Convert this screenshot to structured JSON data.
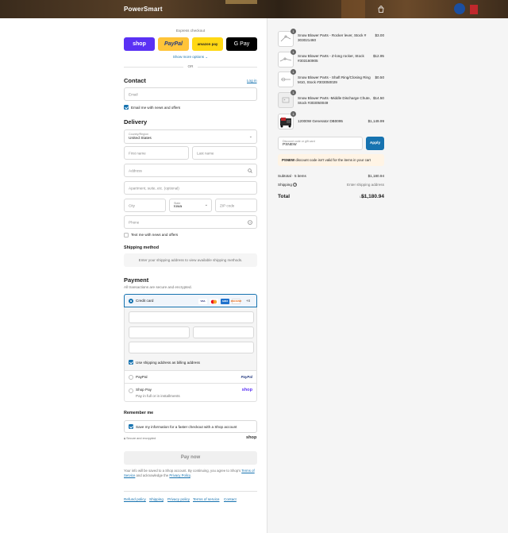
{
  "header": {
    "brand": "PowerSmart"
  },
  "express": {
    "title": "Express checkout",
    "buttons": [
      {
        "label": "shop",
        "color": "#5a31f4"
      },
      {
        "label": "PayPal",
        "color": "#ffc439"
      },
      {
        "label": "amazon pay",
        "color": "#ffd814"
      },
      {
        "label": "G Pay",
        "color": "#000000"
      }
    ],
    "show_more": "Show more options",
    "or": "OR"
  },
  "contact": {
    "title": "Contact",
    "login": "Log in",
    "email_placeholder": "Email",
    "email_news": "Email me with news and offers"
  },
  "delivery": {
    "title": "Delivery",
    "country_label": "Country/Region",
    "country_value": "United States",
    "first_name": "First name",
    "last_name": "Last name",
    "address": "Address",
    "apartment": "Apartment, suite, etc. (optional)",
    "city": "City",
    "state_label": "State",
    "state_value": "Iowa",
    "zip": "ZIP code",
    "phone": "Phone",
    "text_news": "Text me with news and offers"
  },
  "shipping": {
    "title": "Shipping method",
    "message": "Enter your shipping address to view available shipping methods."
  },
  "payment": {
    "title": "Payment",
    "subtitle": "All transactions are secure and encrypted.",
    "credit_card": "Credit card",
    "card_brands": [
      "VISA",
      "MC",
      "AMEX",
      "DISCOVER"
    ],
    "more_cards": "+4",
    "billing_same": "Use shipping address as billing address",
    "paypal": "PayPal",
    "paypal_logo": "PayPal",
    "shop_pay": "Shop Pay",
    "shop_pay_sub": "Pay in full or in installments",
    "shop_pay_logo": "shop"
  },
  "remember": {
    "title": "Remember me",
    "save_info": "Save my information for a faster checkout with a Shop account",
    "secure": "Secure and encrypted",
    "shop_logo": "shop"
  },
  "pay_now": "Pay now",
  "disclaimer": {
    "text_a": "Your info will be saved to a Shop account. By continuing, you agree to Shop's",
    "terms": "Terms of Service",
    "text_b": "and acknowledge the",
    "privacy": "Privacy Policy",
    "text_c": "."
  },
  "footer_links": [
    "Refund policy",
    "Shipping",
    "Privacy policy",
    "Terms of service",
    "Contact"
  ],
  "summary": {
    "items": [
      {
        "qty": "1",
        "name": "Snow Blower Parts - Rocker lever, Stock # 303021460",
        "price": "$3.00"
      },
      {
        "qty": "1",
        "name": "Snow Blower Parts - Z-long rocker, Stock #303160905",
        "price": "$12.95"
      },
      {
        "qty": "1",
        "name": "Snow Blower Parts - Shaft Ring/Closing Ring M10, Stock #303050029",
        "price": "$0.50"
      },
      {
        "qty": "1",
        "name": "Snow Blower Parts -Middle Discharge Chute, Stock #303050049",
        "price": "$14.50"
      },
      {
        "qty": "1",
        "name": "12000W Generator DB0095",
        "price": "$1,149.99"
      }
    ],
    "discount_label": "Discount code or gift card",
    "discount_value": "PSNEW",
    "apply": "Apply",
    "error_code": "PSNEW",
    "error_text": "discount code isn't valid for the items in your cart",
    "subtotal_label": "Subtotal · 5 items",
    "subtotal_value": "$1,180.94",
    "shipping_label": "Shipping",
    "shipping_value": "Enter shipping address",
    "total_label": "Total",
    "currency": "USD",
    "total_value": "$1,180.94"
  }
}
